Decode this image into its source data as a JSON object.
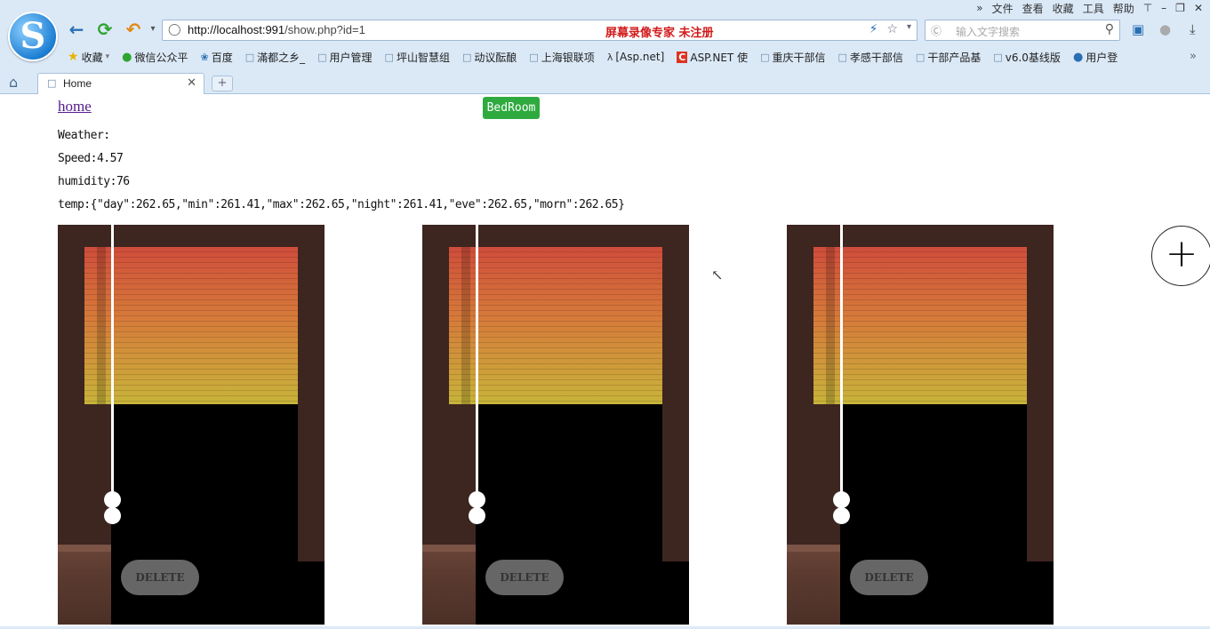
{
  "browser": {
    "logo_letter": "S",
    "menu": [
      "»",
      "文件",
      "查看",
      "收藏",
      "工具",
      "帮助"
    ],
    "window_controls": [
      "⊤",
      "–",
      "❐",
      "✕"
    ],
    "url_host": "http://localhost:991",
    "url_path": "/show.php?id=1",
    "banner": "屏幕录像专家  未注册",
    "search_placeholder": "输入文字搜索",
    "bookmarks": [
      {
        "label": "收藏",
        "icon": "star-icon"
      },
      {
        "label": "微信公众平",
        "icon": "wechat-icon"
      },
      {
        "label": "百度",
        "icon": "baidu-icon"
      },
      {
        "label": "滿都之乡_",
        "icon": "page-icon"
      },
      {
        "label": "用户管理",
        "icon": "page-icon"
      },
      {
        "label": "坪山智慧组",
        "icon": "page-icon"
      },
      {
        "label": "动议酝酿",
        "icon": "page-icon"
      },
      {
        "label": "上海银联项",
        "icon": "page-icon"
      },
      {
        "label": "[Asp.net]",
        "icon": "page-icon"
      },
      {
        "label": "ASP.NET 使",
        "icon": "csdn-icon"
      },
      {
        "label": "重庆干部信",
        "icon": "page-icon"
      },
      {
        "label": "孝感干部信",
        "icon": "page-icon"
      },
      {
        "label": "干部产品基",
        "icon": "page-icon"
      },
      {
        "label": "v6.0基线版",
        "icon": "page-icon"
      },
      {
        "label": "用户登",
        "icon": "globe-icon"
      }
    ],
    "tab_title": "Home",
    "new_tab": "+"
  },
  "page": {
    "home_link": "home",
    "room_button": "BedRoom",
    "weather": "Weather:",
    "speed": "Speed:4.57",
    "humidity": "humidity:76",
    "temp": "temp:{\"day\":262.65,\"min\":261.41,\"max\":262.65,\"night\":261.41,\"eve\":262.65,\"morn\":262.65}",
    "add_button": "+",
    "cards": [
      {
        "delete_label": "DELETE"
      },
      {
        "delete_label": "DELETE"
      },
      {
        "delete_label": "DELETE"
      }
    ]
  }
}
